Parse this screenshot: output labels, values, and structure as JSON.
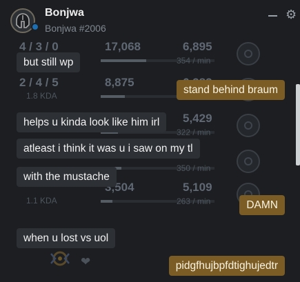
{
  "header": {
    "username": "Bonjwa",
    "tagline": "Bonjwa #2006",
    "avatar_icon": "helmet-icon",
    "status_color": "#1d6fb3"
  },
  "background_stats": [
    {
      "kda": "4 / 3 / 0",
      "damage": "17,068",
      "gold": "6,895",
      "gold_rate": "354 / min",
      "damage_share": 0.4
    },
    {
      "kda": "2 / 4 / 5",
      "kda_ratio": "1.8 KDA",
      "damage": "8,875",
      "gold": "6,282",
      "gold_rate": "",
      "damage_share": 0.21
    },
    {
      "kda": "",
      "damage": "",
      "gold": "5,429",
      "gold_rate": "322 / min",
      "damage_share": 0.15
    },
    {
      "kda": "",
      "kda_ratio": "",
      "damage": "",
      "gold": "",
      "gold_rate": "350 / min",
      "damage_share": 0.18
    },
    {
      "kda": "",
      "kda_ratio": "1.1 KDA",
      "damage": "3,504",
      "gold": "5,109",
      "gold_rate": "263 / min",
      "damage_share": 0.1
    }
  ],
  "messages": [
    {
      "side": "received",
      "text": "but still wp"
    },
    {
      "side": "sent",
      "text": "stand behind braum"
    },
    {
      "side": "received",
      "text": "helps u kinda look like him irl"
    },
    {
      "side": "received",
      "text": "atleast i think it was u i saw on my tl"
    },
    {
      "side": "received",
      "text": "with the mustache"
    },
    {
      "side": "sent",
      "text": "DAMN"
    },
    {
      "side": "received",
      "text": "when u lost vs uol"
    },
    {
      "side": "sent",
      "text": "pidgfhujbpfdtighujedtr"
    }
  ],
  "colors": {
    "received_bubble": "#2d3034",
    "sent_bubble": "#7a5c24",
    "background": "#1c1e21"
  }
}
